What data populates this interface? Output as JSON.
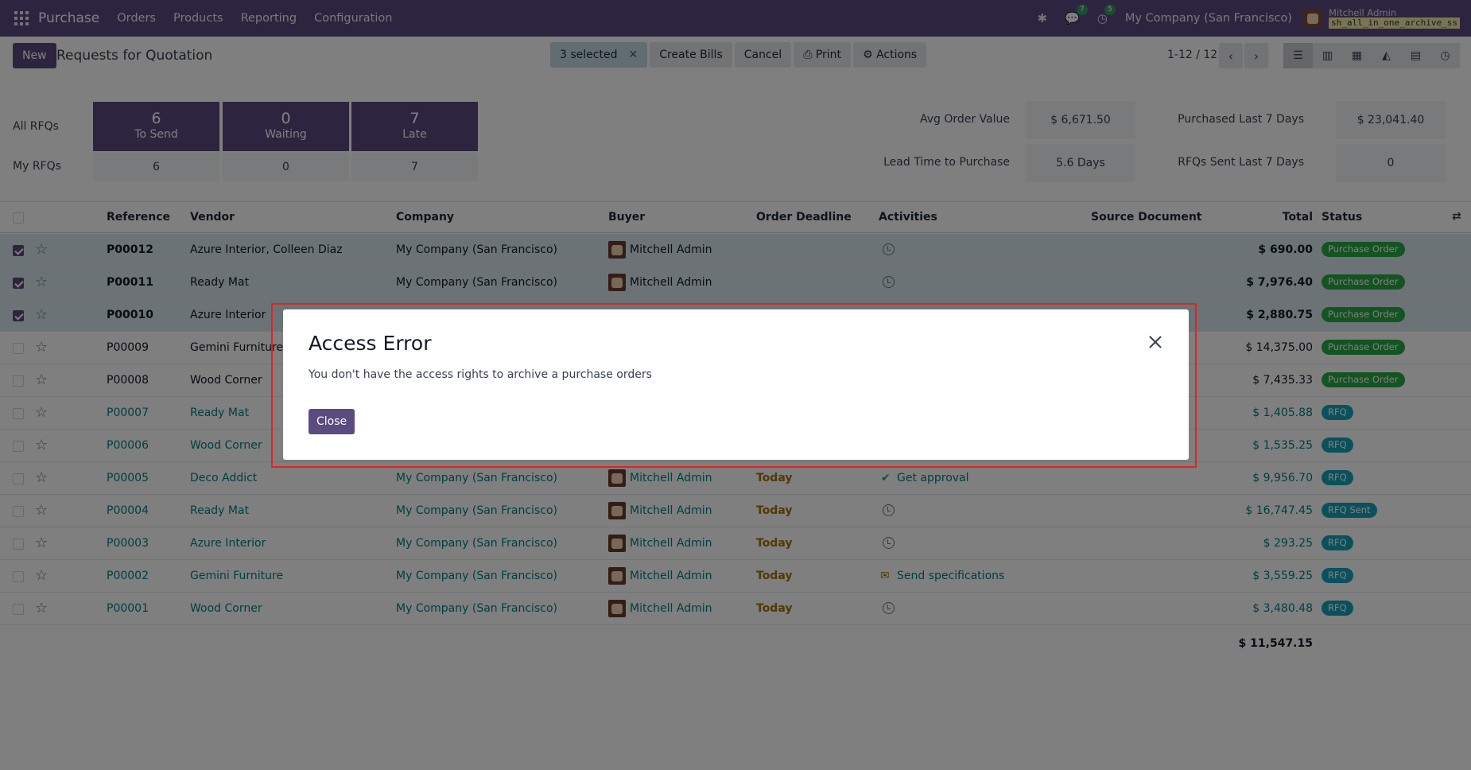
{
  "navbar": {
    "app_name": "Purchase",
    "menus": [
      "Orders",
      "Products",
      "Reporting",
      "Configuration"
    ],
    "messages_count": "7",
    "activities_count": "5",
    "company": "My Company (San Francisco)",
    "user_name": "Mitchell Admin",
    "database": "sh_all_in_one_archive_ss"
  },
  "control_panel": {
    "new_label": "New",
    "title": "Requests for Quotation",
    "selected_label": "3 selected",
    "create_bills_label": "Create Bills",
    "cancel_label": "Cancel",
    "print_label": "Print",
    "actions_label": "Actions",
    "pager": "1-12 / 12"
  },
  "dashboard": {
    "all_label": "All RFQs",
    "my_label": "My RFQs",
    "tiles": [
      {
        "num": "6",
        "label": "To Send",
        "my": "6"
      },
      {
        "num": "0",
        "label": "Waiting",
        "my": "0"
      },
      {
        "num": "7",
        "label": "Late",
        "my": "7"
      }
    ],
    "stats": {
      "avg_order_label": "Avg Order Value",
      "avg_order_value": "$ 6,671.50",
      "purchased_label": "Purchased Last 7 Days",
      "purchased_value": "$ 23,041.40",
      "lead_label": "Lead Time to Purchase",
      "lead_value": "5.6 Days",
      "rfqs_sent_label": "RFQs Sent Last 7 Days",
      "rfqs_sent_value": "0"
    }
  },
  "table": {
    "headers": {
      "reference": "Reference",
      "vendor": "Vendor",
      "company": "Company",
      "buyer": "Buyer",
      "deadline": "Order Deadline",
      "activities": "Activities",
      "source": "Source Document",
      "total": "Total",
      "status": "Status"
    },
    "rows": [
      {
        "ref": "P00012",
        "vendor": "Azure Interior, Colleen Diaz",
        "company": "My Company (San Francisco)",
        "buyer": "Mitchell Admin",
        "deadline": "",
        "activity": "",
        "total": "$ 690.00",
        "status": "Purchase Order"
      },
      {
        "ref": "P00011",
        "vendor": "Ready Mat",
        "company": "My Company (San Francisco)",
        "buyer": "Mitchell Admin",
        "deadline": "",
        "activity": "",
        "total": "$ 7,976.40",
        "status": "Purchase Order"
      },
      {
        "ref": "P00010",
        "vendor": "Azure Interior",
        "company": "",
        "buyer": "",
        "deadline": "",
        "activity": "",
        "total": "$ 2,880.75",
        "status": "Purchase Order"
      },
      {
        "ref": "P00009",
        "vendor": "Gemini Furniture",
        "company": "",
        "buyer": "",
        "deadline": "",
        "activity": "",
        "total": "$ 14,375.00",
        "status": "Purchase Order"
      },
      {
        "ref": "P00008",
        "vendor": "Wood Corner",
        "company": "",
        "buyer": "",
        "deadline": "",
        "activity": "",
        "total": "$ 7,435.33",
        "status": "Purchase Order"
      },
      {
        "ref": "P00007",
        "vendor": "Ready Mat",
        "company": "",
        "buyer": "",
        "deadline": "",
        "activity": "",
        "total": "$ 1,405.88",
        "status": "RFQ"
      },
      {
        "ref": "P00006",
        "vendor": "Wood Corner",
        "company": "",
        "buyer": "",
        "deadline": "",
        "activity": "",
        "total": "$ 1,535.25",
        "status": "RFQ"
      },
      {
        "ref": "P00005",
        "vendor": "Deco Addict",
        "company": "My Company (San Francisco)",
        "buyer": "Mitchell Admin",
        "deadline": "Today",
        "activity": "Get approval",
        "total": "$ 9,956.70",
        "status": "RFQ"
      },
      {
        "ref": "P00004",
        "vendor": "Ready Mat",
        "company": "My Company (San Francisco)",
        "buyer": "Mitchell Admin",
        "deadline": "Today",
        "activity": "",
        "total": "$ 16,747.45",
        "status": "RFQ Sent"
      },
      {
        "ref": "P00003",
        "vendor": "Azure Interior",
        "company": "My Company (San Francisco)",
        "buyer": "Mitchell Admin",
        "deadline": "Today",
        "activity": "",
        "total": "$ 293.25",
        "status": "RFQ"
      },
      {
        "ref": "P00002",
        "vendor": "Gemini Furniture",
        "company": "My Company (San Francisco)",
        "buyer": "Mitchell Admin",
        "deadline": "Today",
        "activity": "Send specifications",
        "total": "$ 3,559.25",
        "status": "RFQ"
      },
      {
        "ref": "P00001",
        "vendor": "Wood Corner",
        "company": "My Company (San Francisco)",
        "buyer": "Mitchell Admin",
        "deadline": "Today",
        "activity": "",
        "total": "$ 3,480.48",
        "status": "RFQ"
      }
    ],
    "sum_total": "$ 11,547.15"
  },
  "modal": {
    "title": "Access Error",
    "message": "You don't have the access rights to archive a purchase orders",
    "close_label": "Close"
  },
  "colors": {
    "brand": "#5b4b7e",
    "link": "#017e84",
    "highlight_border": "#e0241f"
  }
}
